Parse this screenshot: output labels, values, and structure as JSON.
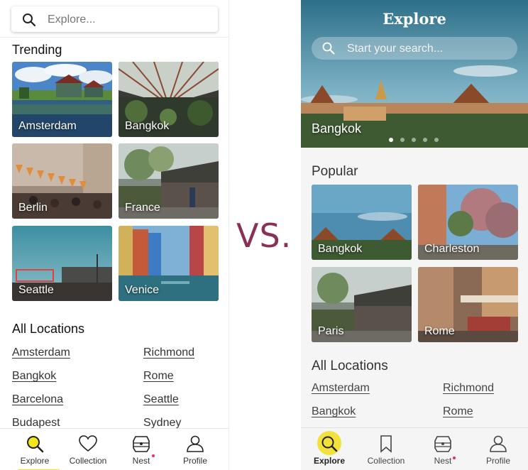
{
  "comparison_label": "VS.",
  "left": {
    "search": {
      "placeholder": "Explore..."
    },
    "trending": {
      "title": "Trending",
      "tiles": [
        {
          "label": "Amsterdam"
        },
        {
          "label": "Bangkok"
        },
        {
          "label": "Berlin"
        },
        {
          "label": "France"
        },
        {
          "label": "Seattle"
        },
        {
          "label": "Venice"
        }
      ]
    },
    "all_locations": {
      "title": "All Locations",
      "left_column": [
        "Amsterdam",
        "Bangkok",
        "Barcelona",
        "Budapest"
      ],
      "right_column": [
        "Richmond",
        "Rome",
        "Seattle",
        "Sydney"
      ]
    },
    "nav": [
      "Explore",
      "Collection",
      "Nest",
      "Profile"
    ],
    "active_tab": "Explore",
    "accent_color": "#f5e61b"
  },
  "right": {
    "hero": {
      "title": "Explore",
      "search_placeholder": "Start your search...",
      "city": "Bangkok",
      "carousel_dots": 5,
      "active_dot": 1
    },
    "popular": {
      "title": "Popular",
      "tiles": [
        {
          "label": "Bangkok"
        },
        {
          "label": "Charleston"
        },
        {
          "label": "Paris"
        },
        {
          "label": "Rome"
        }
      ]
    },
    "all_locations": {
      "title": "All Locations",
      "left_column": [
        "Amsterdam",
        "Bangkok"
      ],
      "right_column": [
        "Richmond",
        "Rome"
      ]
    },
    "nav": [
      "Explore",
      "Collection",
      "Nest",
      "Profile"
    ],
    "active_tab": "Explore",
    "accent_color": "#f4e03a"
  }
}
